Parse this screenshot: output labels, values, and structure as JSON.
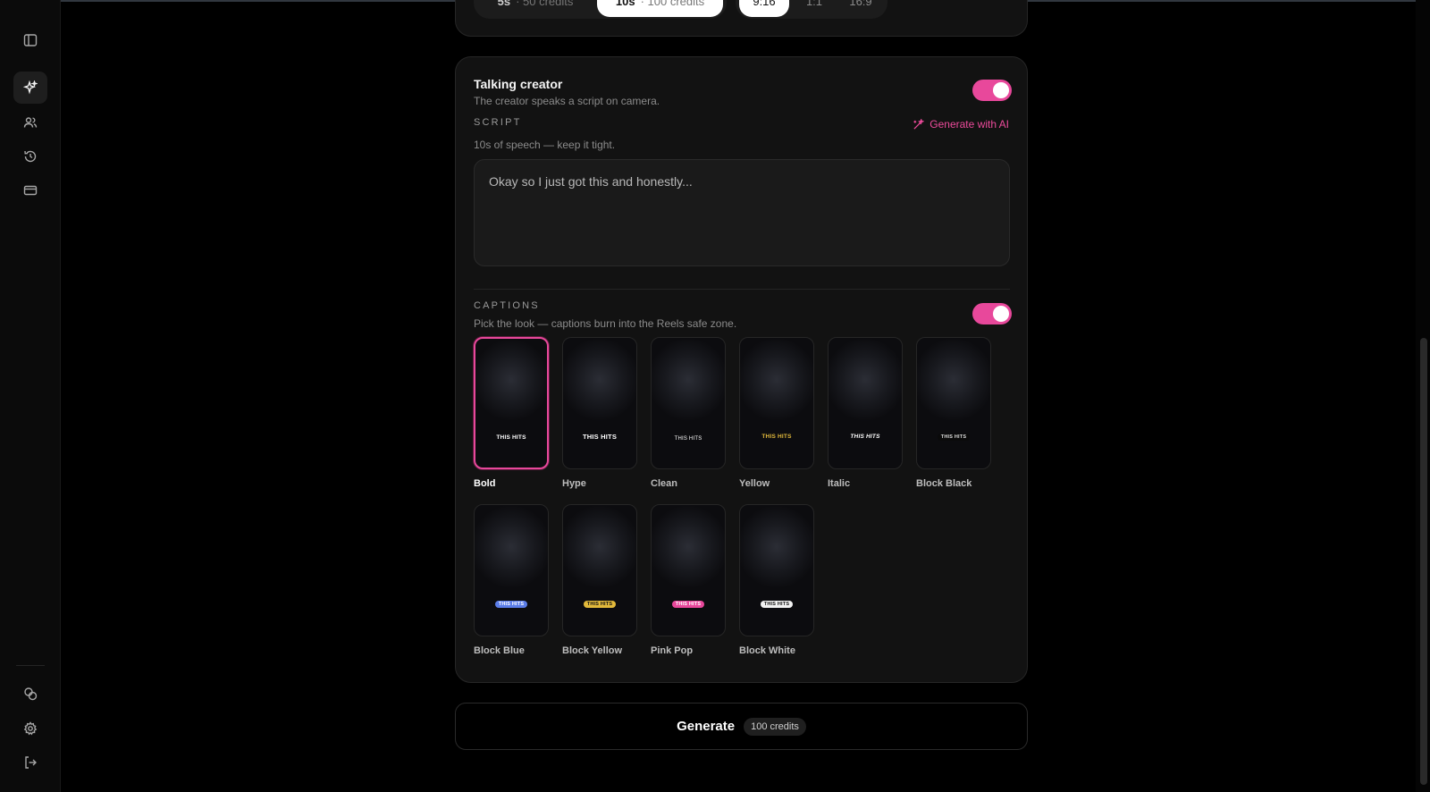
{
  "sidebar": {
    "top_icons": [
      "sidebar-toggle-icon",
      "sparkles-icon",
      "users-icon",
      "history-icon",
      "card-icon"
    ],
    "bottom_icons": [
      "coins-icon",
      "gear-icon",
      "logout-icon"
    ]
  },
  "top_controls": {
    "durations": [
      {
        "value": "5s",
        "credits": "· 50 credits",
        "selected": false
      },
      {
        "value": "10s",
        "credits": "· 100 credits",
        "selected": true
      }
    ],
    "ratios": [
      {
        "label": "9:16",
        "selected": true
      },
      {
        "label": "1:1",
        "selected": false
      },
      {
        "label": "16:9",
        "selected": false
      }
    ]
  },
  "talking_creator": {
    "title": "Talking creator",
    "subtitle": "The creator speaks a script on camera.",
    "enabled": true
  },
  "script": {
    "label": "SCRIPT",
    "generate_ai": "Generate with AI",
    "hint": "10s of speech — keep it tight.",
    "value": "Okay so I just got this and honestly..."
  },
  "captions": {
    "label": "CAPTIONS",
    "hint": "Pick the look — captions burn into the Reels safe zone.",
    "enabled": true,
    "sample_text": "THIS HITS",
    "styles": [
      {
        "name": "Bold",
        "selected": true
      },
      {
        "name": "Hype",
        "selected": false
      },
      {
        "name": "Clean",
        "selected": false
      },
      {
        "name": "Yellow",
        "selected": false
      },
      {
        "name": "Italic",
        "selected": false
      },
      {
        "name": "Block Black",
        "selected": false
      },
      {
        "name": "Block Blue",
        "selected": false
      },
      {
        "name": "Block Yellow",
        "selected": false
      },
      {
        "name": "Pink Pop",
        "selected": false
      },
      {
        "name": "Block White",
        "selected": false
      }
    ]
  },
  "generate": {
    "label": "Generate",
    "credits": "100 credits"
  },
  "colors": {
    "accent": "#e8489b",
    "background": "#000000",
    "panel": "#121212"
  }
}
